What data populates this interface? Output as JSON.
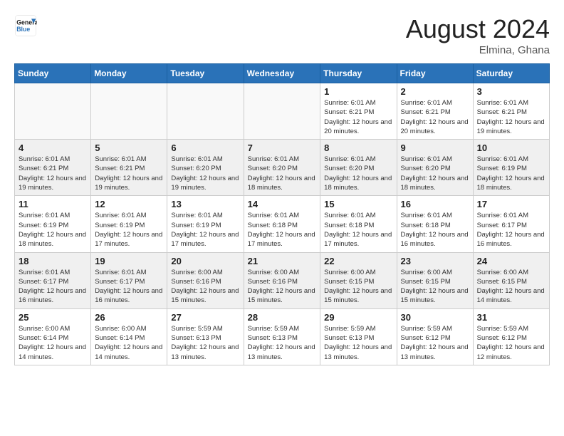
{
  "logo": {
    "line1": "General",
    "line2": "Blue"
  },
  "header": {
    "month": "August 2024",
    "location": "Elmina, Ghana"
  },
  "weekdays": [
    "Sunday",
    "Monday",
    "Tuesday",
    "Wednesday",
    "Thursday",
    "Friday",
    "Saturday"
  ],
  "weeks": [
    [
      {
        "day": "",
        "info": ""
      },
      {
        "day": "",
        "info": ""
      },
      {
        "day": "",
        "info": ""
      },
      {
        "day": "",
        "info": ""
      },
      {
        "day": "1",
        "info": "Sunrise: 6:01 AM\nSunset: 6:21 PM\nDaylight: 12 hours\nand 20 minutes."
      },
      {
        "day": "2",
        "info": "Sunrise: 6:01 AM\nSunset: 6:21 PM\nDaylight: 12 hours\nand 20 minutes."
      },
      {
        "day": "3",
        "info": "Sunrise: 6:01 AM\nSunset: 6:21 PM\nDaylight: 12 hours\nand 19 minutes."
      }
    ],
    [
      {
        "day": "4",
        "info": "Sunrise: 6:01 AM\nSunset: 6:21 PM\nDaylight: 12 hours\nand 19 minutes."
      },
      {
        "day": "5",
        "info": "Sunrise: 6:01 AM\nSunset: 6:21 PM\nDaylight: 12 hours\nand 19 minutes."
      },
      {
        "day": "6",
        "info": "Sunrise: 6:01 AM\nSunset: 6:20 PM\nDaylight: 12 hours\nand 19 minutes."
      },
      {
        "day": "7",
        "info": "Sunrise: 6:01 AM\nSunset: 6:20 PM\nDaylight: 12 hours\nand 18 minutes."
      },
      {
        "day": "8",
        "info": "Sunrise: 6:01 AM\nSunset: 6:20 PM\nDaylight: 12 hours\nand 18 minutes."
      },
      {
        "day": "9",
        "info": "Sunrise: 6:01 AM\nSunset: 6:20 PM\nDaylight: 12 hours\nand 18 minutes."
      },
      {
        "day": "10",
        "info": "Sunrise: 6:01 AM\nSunset: 6:19 PM\nDaylight: 12 hours\nand 18 minutes."
      }
    ],
    [
      {
        "day": "11",
        "info": "Sunrise: 6:01 AM\nSunset: 6:19 PM\nDaylight: 12 hours\nand 18 minutes."
      },
      {
        "day": "12",
        "info": "Sunrise: 6:01 AM\nSunset: 6:19 PM\nDaylight: 12 hours\nand 17 minutes."
      },
      {
        "day": "13",
        "info": "Sunrise: 6:01 AM\nSunset: 6:19 PM\nDaylight: 12 hours\nand 17 minutes."
      },
      {
        "day": "14",
        "info": "Sunrise: 6:01 AM\nSunset: 6:18 PM\nDaylight: 12 hours\nand 17 minutes."
      },
      {
        "day": "15",
        "info": "Sunrise: 6:01 AM\nSunset: 6:18 PM\nDaylight: 12 hours\nand 17 minutes."
      },
      {
        "day": "16",
        "info": "Sunrise: 6:01 AM\nSunset: 6:18 PM\nDaylight: 12 hours\nand 16 minutes."
      },
      {
        "day": "17",
        "info": "Sunrise: 6:01 AM\nSunset: 6:17 PM\nDaylight: 12 hours\nand 16 minutes."
      }
    ],
    [
      {
        "day": "18",
        "info": "Sunrise: 6:01 AM\nSunset: 6:17 PM\nDaylight: 12 hours\nand 16 minutes."
      },
      {
        "day": "19",
        "info": "Sunrise: 6:01 AM\nSunset: 6:17 PM\nDaylight: 12 hours\nand 16 minutes."
      },
      {
        "day": "20",
        "info": "Sunrise: 6:00 AM\nSunset: 6:16 PM\nDaylight: 12 hours\nand 15 minutes."
      },
      {
        "day": "21",
        "info": "Sunrise: 6:00 AM\nSunset: 6:16 PM\nDaylight: 12 hours\nand 15 minutes."
      },
      {
        "day": "22",
        "info": "Sunrise: 6:00 AM\nSunset: 6:15 PM\nDaylight: 12 hours\nand 15 minutes."
      },
      {
        "day": "23",
        "info": "Sunrise: 6:00 AM\nSunset: 6:15 PM\nDaylight: 12 hours\nand 15 minutes."
      },
      {
        "day": "24",
        "info": "Sunrise: 6:00 AM\nSunset: 6:15 PM\nDaylight: 12 hours\nand 14 minutes."
      }
    ],
    [
      {
        "day": "25",
        "info": "Sunrise: 6:00 AM\nSunset: 6:14 PM\nDaylight: 12 hours\nand 14 minutes."
      },
      {
        "day": "26",
        "info": "Sunrise: 6:00 AM\nSunset: 6:14 PM\nDaylight: 12 hours\nand 14 minutes."
      },
      {
        "day": "27",
        "info": "Sunrise: 5:59 AM\nSunset: 6:13 PM\nDaylight: 12 hours\nand 13 minutes."
      },
      {
        "day": "28",
        "info": "Sunrise: 5:59 AM\nSunset: 6:13 PM\nDaylight: 12 hours\nand 13 minutes."
      },
      {
        "day": "29",
        "info": "Sunrise: 5:59 AM\nSunset: 6:13 PM\nDaylight: 12 hours\nand 13 minutes."
      },
      {
        "day": "30",
        "info": "Sunrise: 5:59 AM\nSunset: 6:12 PM\nDaylight: 12 hours\nand 13 minutes."
      },
      {
        "day": "31",
        "info": "Sunrise: 5:59 AM\nSunset: 6:12 PM\nDaylight: 12 hours\nand 12 minutes."
      }
    ]
  ]
}
